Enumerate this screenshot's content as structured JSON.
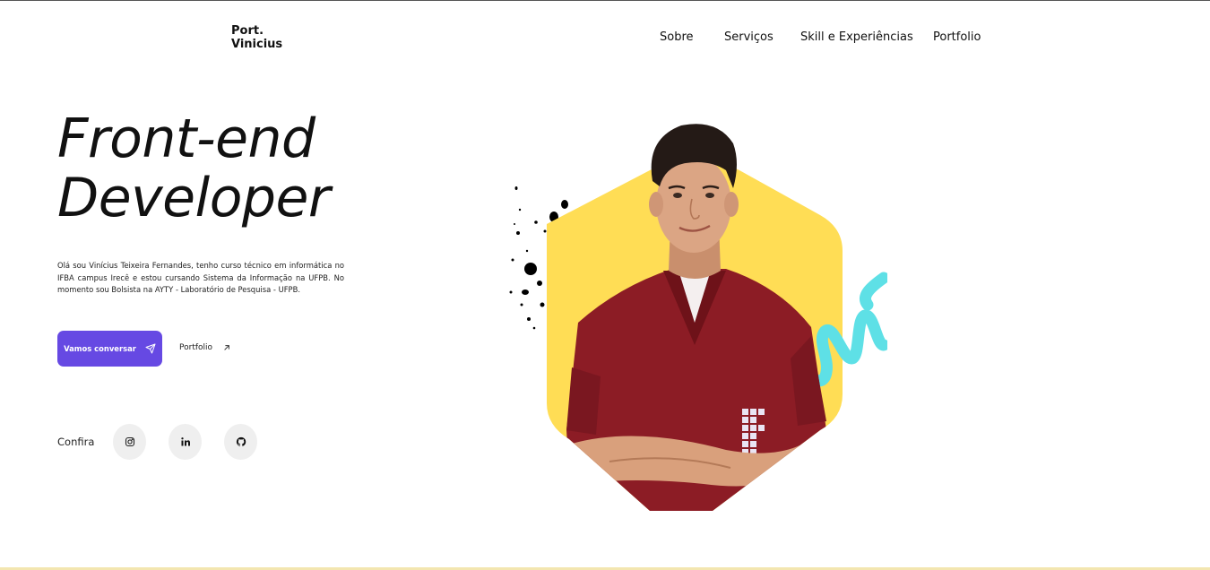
{
  "brand": {
    "line1": "Port.",
    "line2": "Vinicius"
  },
  "nav": {
    "items": [
      "Sobre",
      "Serviços",
      "Skill e Experiências",
      "Portfolio"
    ]
  },
  "hero": {
    "title_line1": "Front-end",
    "title_line2": "Developer",
    "intro": "Olá sou Vinícius Teixeira Fernandes, tenho curso técnico em informática no IFBA campus Irecê e estou cursando Sistema da Informação na UFPB. No momento sou Bolsista na AYTY - Laboratório de Pesquisa - UFPB.",
    "cta_label": "Vamos conversar",
    "cta_icon": "paper-plane-icon",
    "secondary_label": "Portfolio",
    "secondary_icon": "arrow-up-right-icon"
  },
  "social": {
    "label": "Confira",
    "items": [
      {
        "icon": "instagram-icon"
      },
      {
        "icon": "linkedin-icon"
      },
      {
        "icon": "github-icon"
      }
    ]
  },
  "colors": {
    "accent": "#6649e3",
    "hexagon": "#ffdd55",
    "scribble": "#5ee0e6",
    "shirt": "#8c1c25"
  }
}
